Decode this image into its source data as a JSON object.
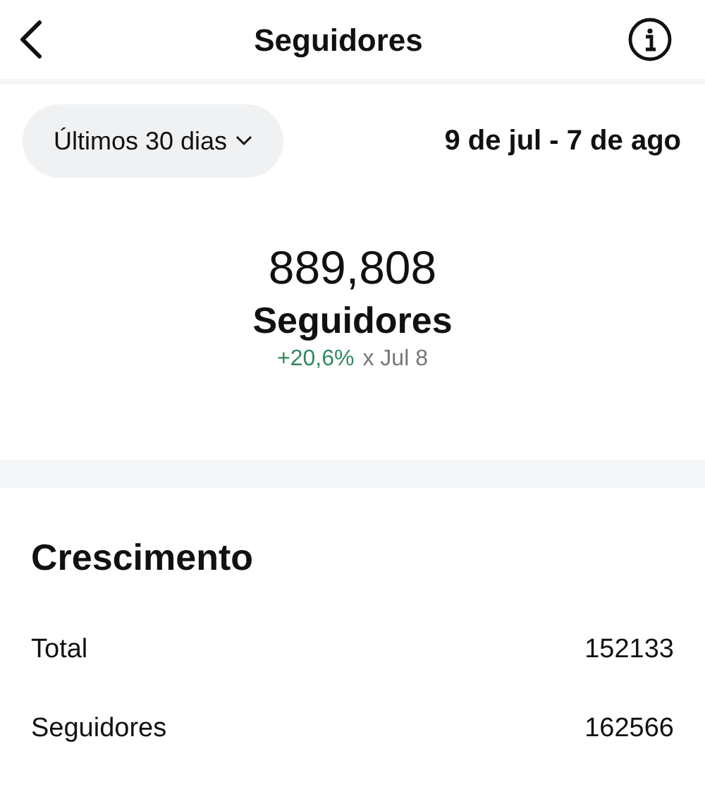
{
  "header": {
    "title": "Seguidores"
  },
  "filter": {
    "period": "Últimos 30 dias",
    "range": "9 de jul - 7 de ago"
  },
  "summary": {
    "value": "889,808",
    "label": "Seguidores",
    "change": "+20,6%",
    "compare": "x Jul 8"
  },
  "growth": {
    "title": "Crescimento",
    "rows": [
      {
        "label": "Total",
        "value": "152133"
      },
      {
        "label": "Seguidores",
        "value": "162566"
      }
    ]
  }
}
